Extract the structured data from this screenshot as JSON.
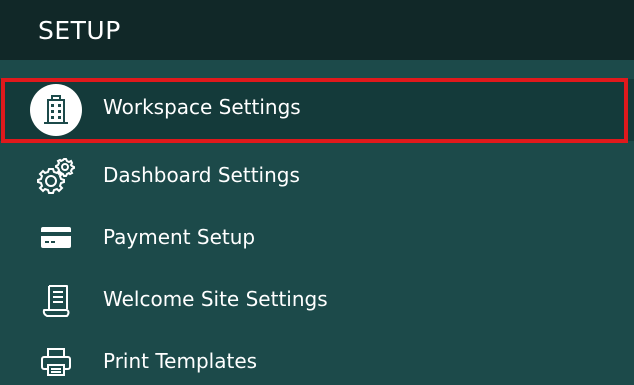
{
  "header": {
    "title": "SETUP"
  },
  "colors": {
    "header_bg": "#112828",
    "panel_bg": "#1c4a4a",
    "active_bg": "#143a3a",
    "highlight_border": "#e0191c",
    "text": "#ffffff"
  },
  "menu": {
    "items": [
      {
        "label": "Workspace Settings",
        "icon": "building-icon",
        "active": true
      },
      {
        "label": "Dashboard Settings",
        "icon": "gears-icon",
        "active": false
      },
      {
        "label": "Payment Setup",
        "icon": "credit-card-icon",
        "active": false
      },
      {
        "label": "Welcome Site Settings",
        "icon": "scroll-icon",
        "active": false
      },
      {
        "label": "Print Templates",
        "icon": "printer-icon",
        "active": false
      }
    ]
  }
}
